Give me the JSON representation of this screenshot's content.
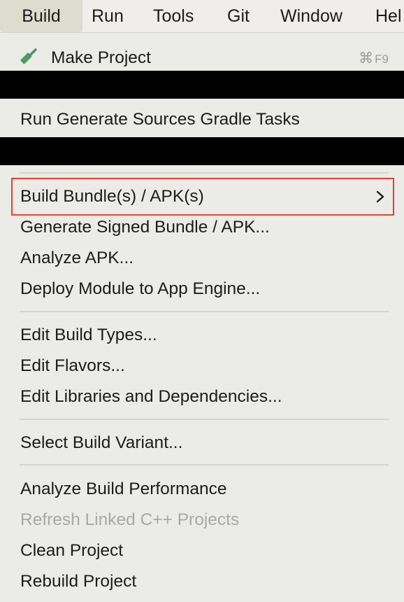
{
  "menubar": {
    "items": [
      {
        "label": "Build",
        "active": true
      },
      {
        "label": "Run"
      },
      {
        "label": "Tools"
      },
      {
        "label": "Git"
      },
      {
        "label": "Window"
      },
      {
        "label": "Hel"
      }
    ]
  },
  "menu": {
    "make_project": {
      "label": "Make Project",
      "icon": "hammer-icon",
      "shortcut_symbol": "⌘",
      "shortcut_key": "F9"
    },
    "run_generate_sources": "Run Generate Sources Gradle Tasks",
    "build_bundle": {
      "label": "Build Bundle(s) / APK(s)",
      "icon": "chevron-right-icon",
      "highlight_color": "#e0442f"
    },
    "generate_signed": "Generate Signed Bundle / APK...",
    "analyze_apk": "Analyze APK...",
    "deploy_module": "Deploy Module to App Engine...",
    "edit_build_types": "Edit Build Types...",
    "edit_flavors": "Edit Flavors...",
    "edit_libraries": "Edit Libraries and Dependencies...",
    "select_build_variant": "Select Build Variant...",
    "analyze_build_performance": "Analyze Build Performance",
    "refresh_linked_cpp": {
      "label": "Refresh Linked C++ Projects",
      "disabled": true
    },
    "clean_project": "Clean Project",
    "rebuild_project": "Rebuild Project"
  },
  "colors": {
    "menu_background": "#ebebe7",
    "active_menubar_item": "#dcdccf",
    "hammer_green": "#4e9a5f",
    "disabled_text": "#a9a9a6",
    "redaction": "#000000"
  }
}
